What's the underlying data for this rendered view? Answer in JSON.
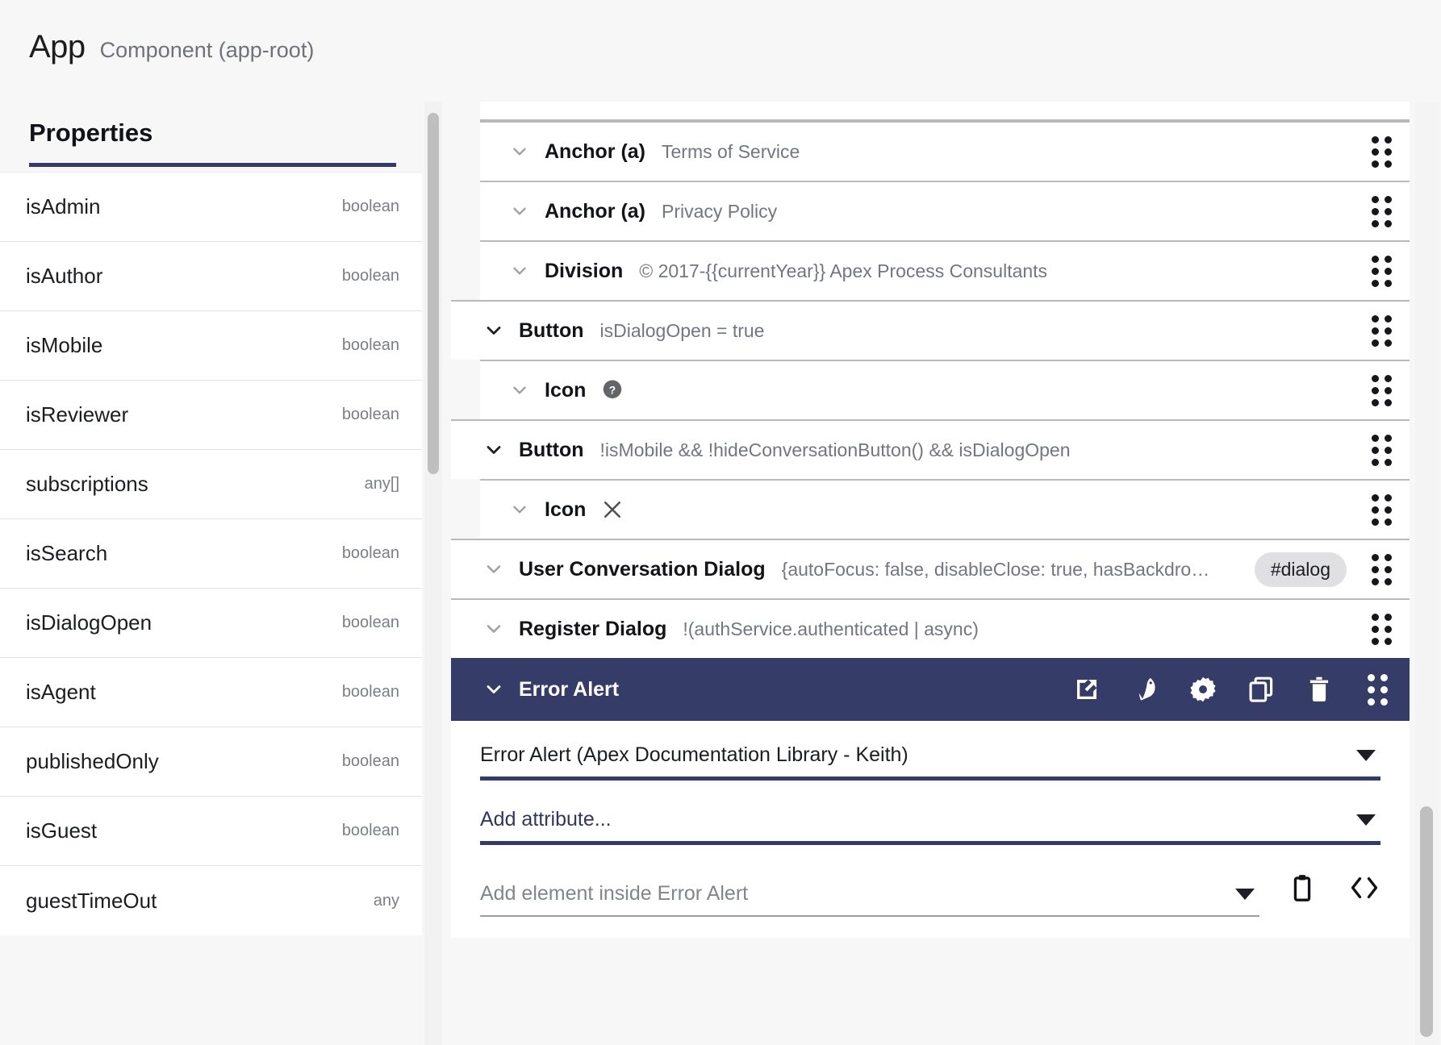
{
  "header": {
    "title": "App",
    "subtitle": "Component (app-root)"
  },
  "left_panel": {
    "section_title": "Properties",
    "properties": [
      {
        "name": "isAdmin",
        "type": "boolean"
      },
      {
        "name": "isAuthor",
        "type": "boolean"
      },
      {
        "name": "isMobile",
        "type": "boolean"
      },
      {
        "name": "isReviewer",
        "type": "boolean"
      },
      {
        "name": "subscriptions",
        "type": "any[]"
      },
      {
        "name": "isSearch",
        "type": "boolean"
      },
      {
        "name": "isDialogOpen",
        "type": "boolean"
      },
      {
        "name": "isAgent",
        "type": "boolean"
      },
      {
        "name": "publishedOnly",
        "type": "boolean"
      },
      {
        "name": "isGuest",
        "type": "boolean"
      },
      {
        "name": "guestTimeOut",
        "type": "any"
      }
    ]
  },
  "tree": {
    "nodes": [
      {
        "label": "Anchor (a)",
        "meta": "Terms of Service",
        "indent": 1,
        "icon": "",
        "badge": ""
      },
      {
        "label": "Anchor (a)",
        "meta": "Privacy Policy",
        "indent": 1,
        "icon": "",
        "badge": ""
      },
      {
        "label": "Division",
        "meta": "© 2017-{{currentYear}} Apex Process Consultants",
        "indent": 1,
        "icon": "",
        "badge": ""
      },
      {
        "label": "Button",
        "meta": "isDialogOpen = true",
        "indent": 0,
        "icon": "",
        "badge": ""
      },
      {
        "label": "Icon",
        "meta": "",
        "indent": 1,
        "icon": "help-icon",
        "badge": ""
      },
      {
        "label": "Button",
        "meta": "!isMobile && !hideConversationButton() && isDialogOpen",
        "indent": 0,
        "icon": "",
        "badge": ""
      },
      {
        "label": "Icon",
        "meta": "",
        "indent": 1,
        "icon": "close-icon",
        "badge": ""
      },
      {
        "label": "User Conversation Dialog",
        "meta": "{autoFocus: false, disableClose: true, hasBackdro…",
        "indent": 0,
        "icon": "",
        "badge": "#dialog"
      },
      {
        "label": "Register Dialog",
        "meta": "!(authService.authenticated | async)",
        "indent": 0,
        "icon": "",
        "badge": ""
      }
    ],
    "selected_node": {
      "label": "Error Alert",
      "toolbar": [
        {
          "name": "open-in-new-icon",
          "title": "Open"
        },
        {
          "name": "paint-brush-icon",
          "title": "Style"
        },
        {
          "name": "gear-icon",
          "title": "Settings"
        },
        {
          "name": "copy-icon",
          "title": "Duplicate"
        },
        {
          "name": "trash-icon",
          "title": "Delete"
        },
        {
          "name": "drag-handle-icon",
          "title": "Drag"
        }
      ]
    }
  },
  "form": {
    "component_select": {
      "value": "Error Alert (Apex Documentation Library - Keith)",
      "dropdown_icon": "chevron-down-icon"
    },
    "attribute_select": {
      "placeholder": "Add attribute...",
      "dropdown_icon": "chevron-down-icon"
    },
    "add_element_select": {
      "placeholder": "Add element inside Error Alert",
      "dropdown_icon": "chevron-down-icon"
    },
    "trailing_actions": [
      {
        "name": "paste-clipboard-icon",
        "label": "Paste"
      },
      {
        "name": "code-brackets-icon",
        "label": "Code"
      }
    ]
  },
  "colors": {
    "accent": "#36396b",
    "selected_row": "#363c68",
    "panel_bg": "#f7f7f8",
    "row_bg": "#ffffff",
    "muted_text": "#737680"
  }
}
